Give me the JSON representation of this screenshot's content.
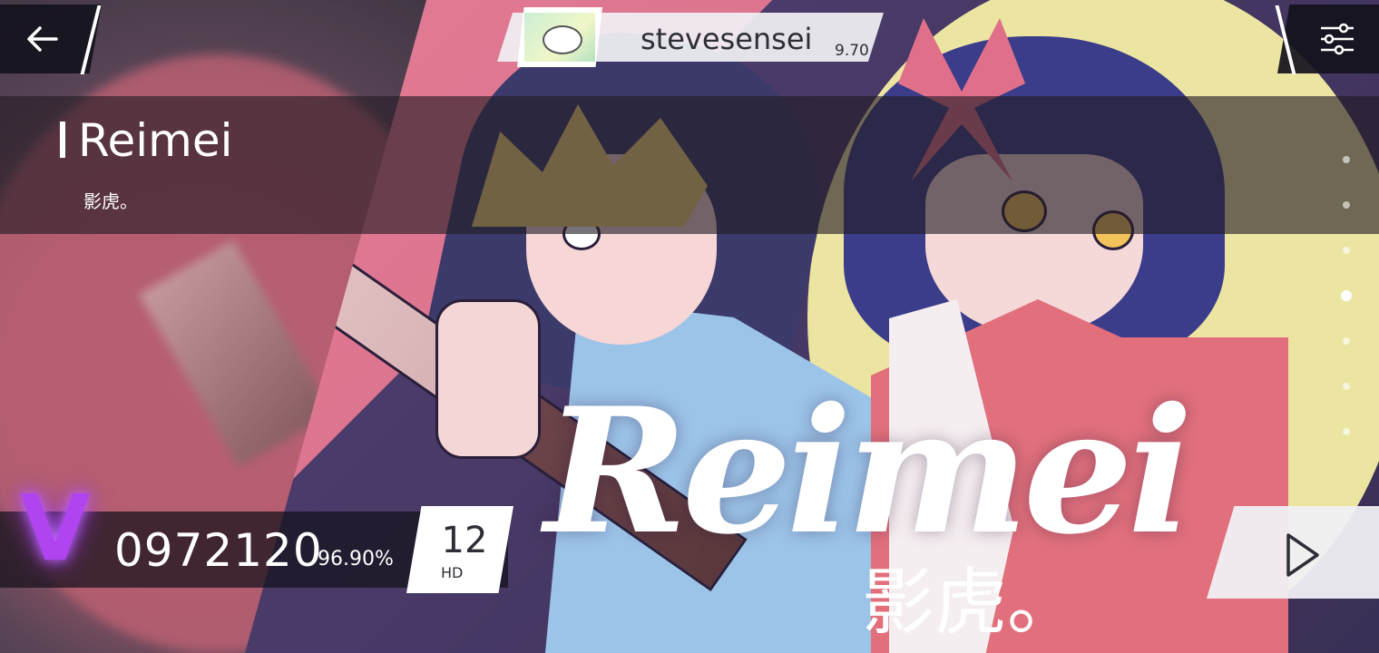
{
  "user": {
    "name": "stevesensei",
    "rating": "9.70"
  },
  "song": {
    "title": "Reimei",
    "artist": "影虎。"
  },
  "artwork": {
    "logo_title": "Reimei",
    "logo_artist": "影虎。"
  },
  "result": {
    "rank": "V",
    "score": "0972120",
    "accuracy": "96.90%"
  },
  "chart": {
    "level": "12",
    "difficulty": "HD"
  },
  "pager": {
    "count": 7,
    "active_index": 3
  },
  "colors": {
    "rank_glow": "#b044f0",
    "panel_dark": "#14101a",
    "panel_light": "#f0f0f4"
  },
  "icons": {
    "back": "arrow-left-icon",
    "settings": "sliders-icon",
    "play": "play-triangle-icon"
  }
}
